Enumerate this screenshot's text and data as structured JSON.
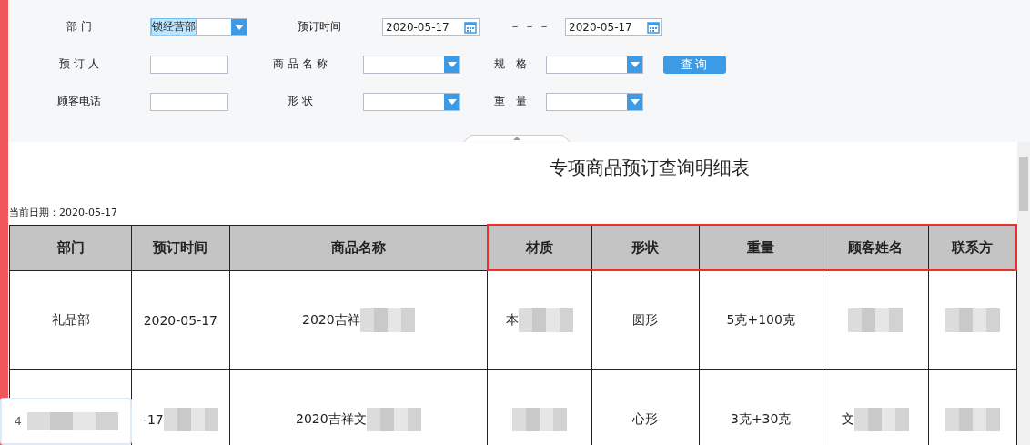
{
  "filters": [
    [
      {
        "label": "部 门",
        "kind": "select",
        "value": "锁经营部",
        "highlighted": true
      },
      {
        "label": "预订时间",
        "kind": "date_range",
        "value": "2020-05-17",
        "separator": "－－－",
        "value_end": "2020-05-17"
      }
    ],
    [
      {
        "label": "预 订 人",
        "kind": "text"
      },
      {
        "label": "商 品 名 称",
        "kind": "select"
      },
      {
        "label": "规 格",
        "kind": "select"
      },
      {
        "label": "查询",
        "kind": "button"
      }
    ],
    [
      {
        "label": "顾客电话",
        "kind": "text"
      },
      {
        "label": "形 状",
        "kind": "select"
      },
      {
        "label": "重 量",
        "kind": "select"
      }
    ]
  ],
  "report": {
    "title": "专项商品预订查询明细表",
    "date_line": "当前日期：2020-05-17",
    "columns": [
      {
        "label": "部门",
        "highlighted": false
      },
      {
        "label": "预订时间",
        "highlighted": false
      },
      {
        "label": "商品名称",
        "highlighted": false
      },
      {
        "label": "材质",
        "highlighted": true
      },
      {
        "label": "形状",
        "highlighted": true
      },
      {
        "label": "重量",
        "highlighted": true
      },
      {
        "label": "顾客姓名",
        "highlighted": true
      },
      {
        "label": "联系方",
        "highlighted": true
      }
    ],
    "rows": [
      [
        {
          "text": "礼品部",
          "redacted": false
        },
        {
          "text": "2020-05-17",
          "redacted": false
        },
        {
          "text": "2020吉祥",
          "redacted": true
        },
        {
          "text": "本",
          "redacted": true
        },
        {
          "text": "圆形",
          "redacted": false
        },
        {
          "text": "5克+100克",
          "redacted": false
        },
        {
          "text": "",
          "redacted": true
        },
        {
          "text": "",
          "redacted": true
        }
      ],
      [
        {
          "text": "",
          "redacted": false
        },
        {
          "text": "-17",
          "redacted": true
        },
        {
          "text": "2020吉祥文",
          "redacted": true
        },
        {
          "text": "",
          "redacted": true
        },
        {
          "text": "心形",
          "redacted": false
        },
        {
          "text": "3克+30克",
          "redacted": false
        },
        {
          "text": "文",
          "redacted": true
        },
        {
          "text": "",
          "redacted": true
        }
      ]
    ]
  },
  "popup": {
    "text": "4"
  }
}
